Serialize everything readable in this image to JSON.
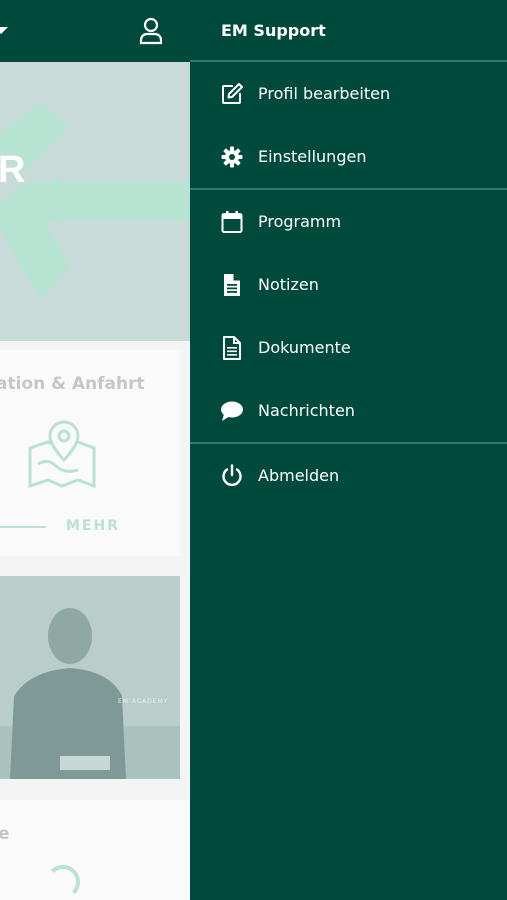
{
  "background_app": {
    "location_card": {
      "title": "ation & Anfahrt",
      "more_label": "MEHR"
    },
    "video": {
      "overlay_text": "EM ACADEMY"
    },
    "second_card": {
      "title": "e"
    },
    "hero_logo_letter": "R"
  },
  "drawer": {
    "title": "EM Support",
    "groups": [
      [
        {
          "label": "Profil bearbeiten",
          "icon": "edit-icon"
        },
        {
          "label": "Einstellungen",
          "icon": "gear-icon"
        }
      ],
      [
        {
          "label": "Programm",
          "icon": "calendar-icon"
        },
        {
          "label": "Notizen",
          "icon": "note-icon"
        },
        {
          "label": "Dokumente",
          "icon": "document-icon"
        },
        {
          "label": "Nachrichten",
          "icon": "chat-bubble-icon"
        }
      ],
      [
        {
          "label": "Abmelden",
          "icon": "power-icon"
        }
      ]
    ]
  },
  "colors": {
    "drawer_bg": "#004a3b",
    "divider": "#2f7a69",
    "accent_mint": "#b8e3d2"
  }
}
